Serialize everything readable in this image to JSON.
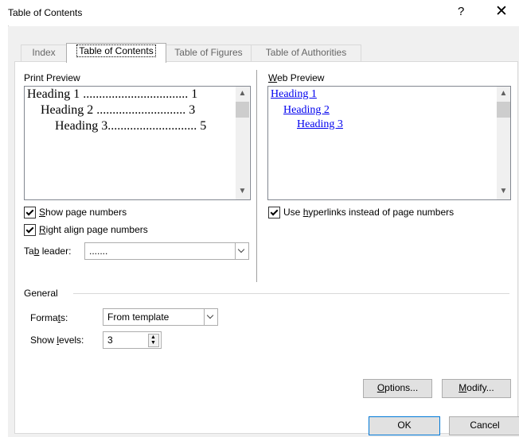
{
  "window": {
    "title": "Table of Contents",
    "help_label": "?",
    "close_label": "✕"
  },
  "tabs": [
    {
      "label": "Index",
      "active": false
    },
    {
      "label": "Table of Contents",
      "active": true
    },
    {
      "label": "Table of Figures",
      "active": false
    },
    {
      "label": "Table of Authorities",
      "active": false
    }
  ],
  "print_preview": {
    "label": "Print Preview",
    "entries": [
      {
        "text": "Heading 1 ................................. 1"
      },
      {
        "text": "Heading 2 ............................ 3"
      },
      {
        "text": "Heading 3............................ 5"
      }
    ]
  },
  "web_preview": {
    "label": "Web Preview",
    "links": [
      "Heading 1",
      "Heading 2",
      "Heading 3"
    ]
  },
  "options": {
    "show_page_numbers": {
      "label": "Show page numbers",
      "checked": true
    },
    "right_align": {
      "label": "Right align page numbers",
      "checked": true
    },
    "use_hyperlinks": {
      "label": "Use hyperlinks instead of page numbers",
      "checked": true
    },
    "tab_leader": {
      "label": "Tab leader:",
      "value": "......."
    }
  },
  "general": {
    "label": "General",
    "formats": {
      "label": "Formats:",
      "value": "From template"
    },
    "show_levels": {
      "label": "Show levels:",
      "value": "3"
    }
  },
  "buttons": {
    "options": "Options...",
    "modify": "Modify...",
    "ok": "OK",
    "cancel": "Cancel"
  }
}
